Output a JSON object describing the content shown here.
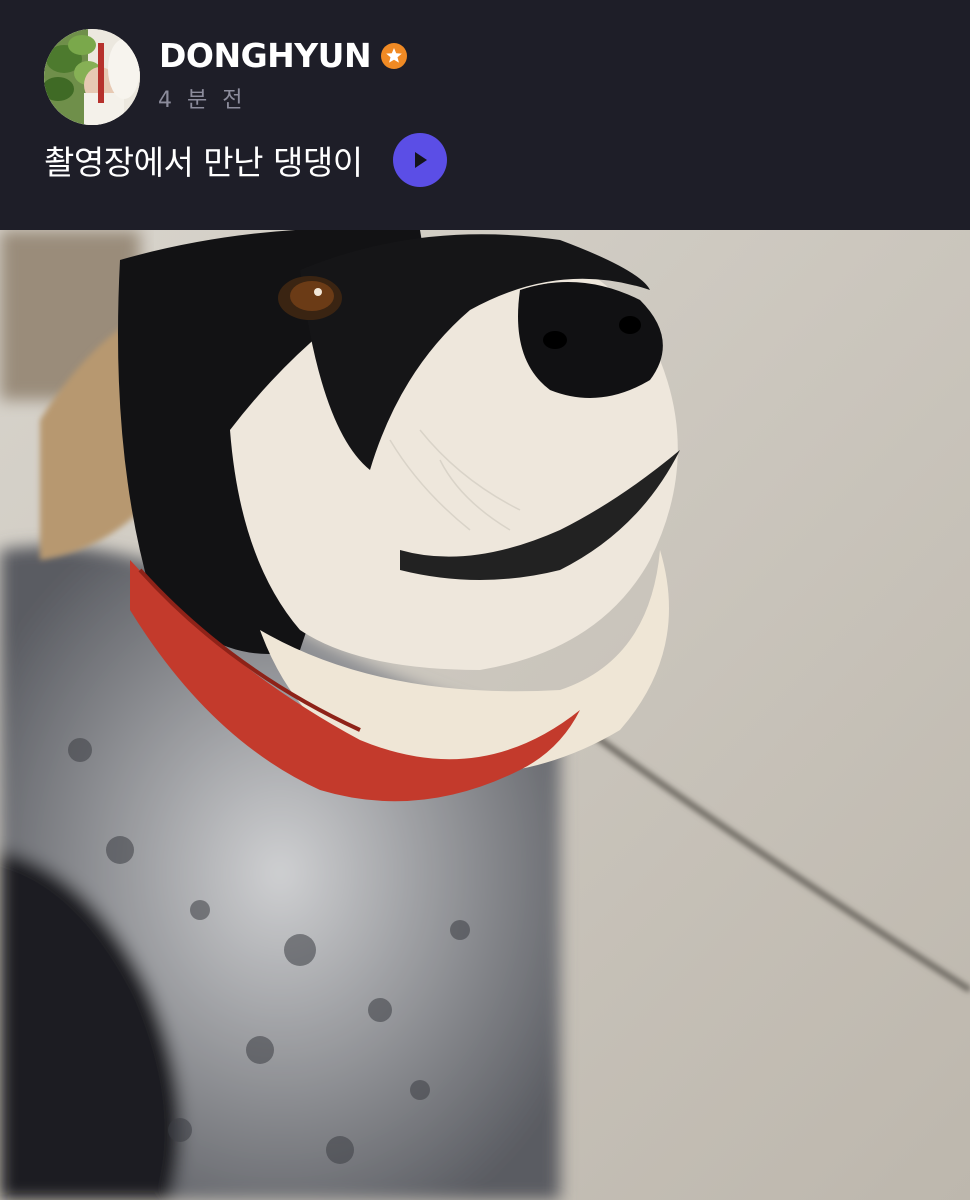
{
  "post": {
    "author": {
      "name": "DONGHYUN",
      "badge_icon": "star-badge-icon",
      "badge_color": "#f08a24"
    },
    "timestamp": "4 분 전",
    "caption": "촬영장에서 만난 댕댕이",
    "translate_button_color": "#5b4ee6",
    "background_color": "#1e1e28",
    "photo": {
      "subject": "dog-photo"
    }
  }
}
